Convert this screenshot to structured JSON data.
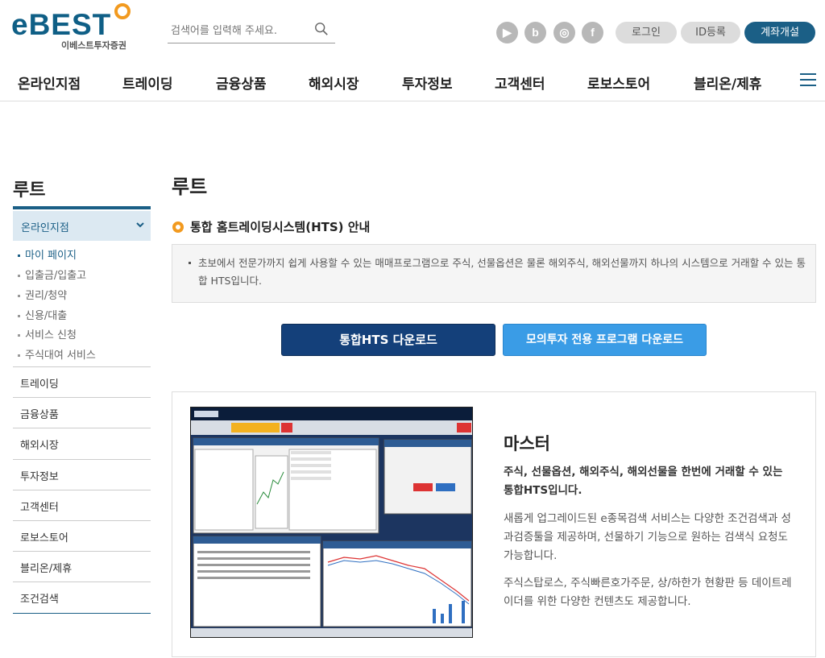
{
  "header": {
    "logo_text": "eBEST",
    "logo_subtitle": "이베스트투자증권",
    "search_placeholder": "검색어를 입력해 주세요.",
    "sns": [
      {
        "name": "youtube-icon",
        "glyph": "▶"
      },
      {
        "name": "blog-icon",
        "glyph": "b"
      },
      {
        "name": "instagram-icon",
        "glyph": "◎"
      },
      {
        "name": "facebook-icon",
        "glyph": "f"
      }
    ],
    "login_label": "로그인",
    "id_register_label": "ID등록",
    "open_account_label": "계좌개설"
  },
  "gnb": [
    "온라인지점",
    "트레이딩",
    "금융상품",
    "해외시장",
    "투자정보",
    "고객센터",
    "로보스토어",
    "블리온/제휴"
  ],
  "lnb": {
    "title": "루트",
    "active_label": "온라인지점",
    "sub_items": [
      "마이 페이지",
      "입출금/입출고",
      "권리/청약",
      "신용/대출",
      "서비스 신청",
      "주식대여 서비스"
    ],
    "items": [
      "트레이딩",
      "금융상품",
      "해외시장",
      "투자정보",
      "고객센터",
      "로보스토어",
      "블리온/제휴",
      "조건검색"
    ]
  },
  "content": {
    "page_title": "루트",
    "section_title": "통합 홈트레이딩시스템(HTS) 안내",
    "info_text": "초보에서 전문가까지 쉽게 사용할 수 있는 매매프로그램으로 주식, 선물옵션은 물론 해외주식, 해외선물까지 하나의 시스템으로 거래할 수 있는 통합 HTS입니다.",
    "btn_hts": "통합HTS 다운로드",
    "btn_mock": "모의투자 전용 프로그램 다운로드",
    "product": {
      "title": "마스터",
      "lead": "주식, 선물옵션, 해외주식, 해외선물을 한번에 거래할 수 있는 통합HTS입니다.",
      "desc1": "새롭게 업그레이드된 e종목검색 서비스는 다양한 조건검색과 성과검증툴을 제공하며, 선물하기 기능으로 원하는 검색식 요청도 가능합니다.",
      "desc2": "주식스탑로스, 주식빠른호가주문, 상/하한가 현황판 등 데이트레이더를 위한 다양한 컨텐츠도 제공합니다."
    }
  },
  "colors": {
    "brand_blue": "#1b5f86",
    "accent_orange": "#f29a1f",
    "btn_dark": "#14407a",
    "btn_light": "#3a9ce6"
  }
}
